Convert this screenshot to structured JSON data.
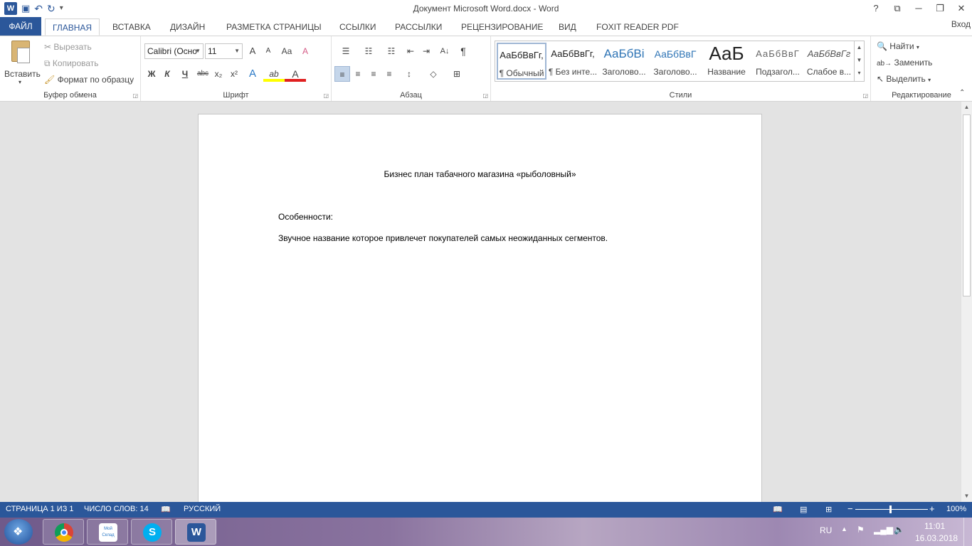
{
  "window": {
    "title": "Документ Microsoft Word.docx - Word",
    "controls": [
      "?",
      "⧉",
      "─",
      "❐",
      "✕"
    ]
  },
  "qat": {
    "undo": "↶",
    "redo": "↻",
    "save": "💾",
    "more": "⌄",
    "logo": "W"
  },
  "tabs": {
    "file": "ФАЙЛ",
    "items": [
      "ГЛАВНАЯ",
      "ВСТАВКА",
      "ДИЗАЙН",
      "РАЗМЕТКА СТРАНИЦЫ",
      "ССЫЛКИ",
      "РАССЫЛКИ",
      "РЕЦЕНЗИРОВАНИЕ",
      "ВИД",
      "FOXIT READER PDF"
    ],
    "signin": "Вход"
  },
  "clipboard": {
    "paste": "Вставить",
    "cut": "Вырезать",
    "copy": "Копировать",
    "format_painter": "Формат по образцу",
    "label": "Буфер обмена"
  },
  "font": {
    "name": "Calibri (Осно",
    "size": "11",
    "grow": "A",
    "shrink": "A",
    "case": "Aa",
    "clear": "A",
    "bold": "Ж",
    "italic": "К",
    "underline": "Ч",
    "strike": "abc",
    "sub": "x₂",
    "sup": "x²",
    "effects": "A",
    "highlight": "ab",
    "color": "A",
    "label": "Шрифт"
  },
  "paragraph": {
    "bullets": "☰",
    "numbering": "☷",
    "multilevel": "☷",
    "decrease_indent": "⇤",
    "increase_indent": "⇥",
    "sort": "A↓",
    "pilcrow": "¶",
    "align_left": "≡",
    "center": "≡",
    "align_right": "≡",
    "justify": "≡",
    "line_spacing": "↕",
    "shading": "◇",
    "borders": "⊞",
    "label": "Абзац"
  },
  "styles": {
    "label": "Стили",
    "items": [
      {
        "sample": "АаБбВвГг,",
        "name": "¶ Обычный"
      },
      {
        "sample": "АаБбВвГг,",
        "name": "¶ Без инте..."
      },
      {
        "sample": "АаБбВі",
        "name": "Заголово..."
      },
      {
        "sample": "АаБбВвГ",
        "name": "Заголово..."
      },
      {
        "sample": "АаБ",
        "name": "Название"
      },
      {
        "sample": "АаБбВвГ",
        "name": "Подзагол..."
      },
      {
        "sample": "АаБбВвГг",
        "name": "Слабое в..."
      }
    ]
  },
  "editing": {
    "find": "Найти",
    "replace": "Заменить",
    "select": "Выделить",
    "label": "Редактирование"
  },
  "document": {
    "title": "Бизнес план табачного магазина «рыболовный»",
    "heading": "Особенности:",
    "paragraph": "Звучное название которое привлечет покупателей самых неожиданных сегментов."
  },
  "statusbar": {
    "page": "СТРАНИЦА 1 ИЗ 1",
    "words": "ЧИСЛО СЛОВ: 14",
    "language": "РУССКИЙ",
    "zoom": "100%",
    "zoom_minus": "−",
    "zoom_plus": "+"
  },
  "taskbar": {
    "apps": [
      {
        "name": "chrome",
        "label": ""
      },
      {
        "name": "moi-sklad",
        "label": "Мой Склад"
      },
      {
        "name": "skype",
        "label": "S"
      },
      {
        "name": "word",
        "label": "W"
      }
    ],
    "lang": "RU",
    "time": "11:01",
    "date": "16.03.2018"
  },
  "colors": {
    "accent": "#2b579a",
    "ribbon_bg": "#ffffff",
    "doc_bg": "#e3e3e3"
  }
}
